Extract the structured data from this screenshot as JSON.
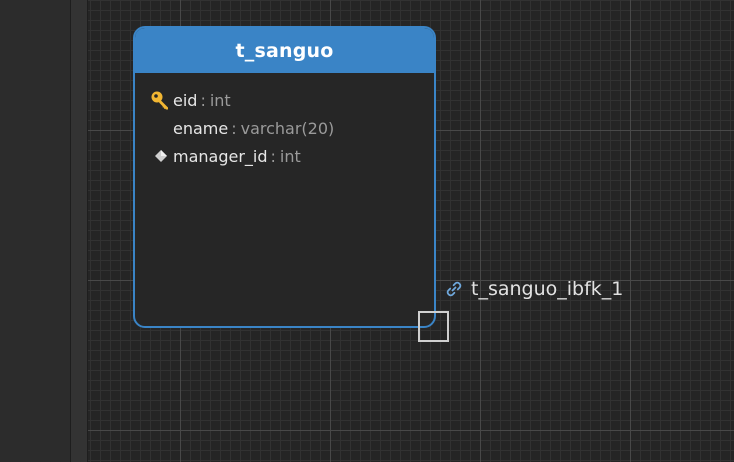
{
  "diagram": {
    "table": {
      "name": "t_sanguo",
      "header_color": "#3a84c6",
      "fields": [
        {
          "name": "eid",
          "type": "int",
          "icon": "primary-key-icon"
        },
        {
          "name": "ename",
          "type": "varchar(20)",
          "icon": ""
        },
        {
          "name": "manager_id",
          "type": "int",
          "icon": "foreign-key-diamond-icon"
        }
      ]
    },
    "relation": {
      "name": "t_sanguo_ibfk_1",
      "icon": "link-icon"
    },
    "type_separator": ":"
  }
}
